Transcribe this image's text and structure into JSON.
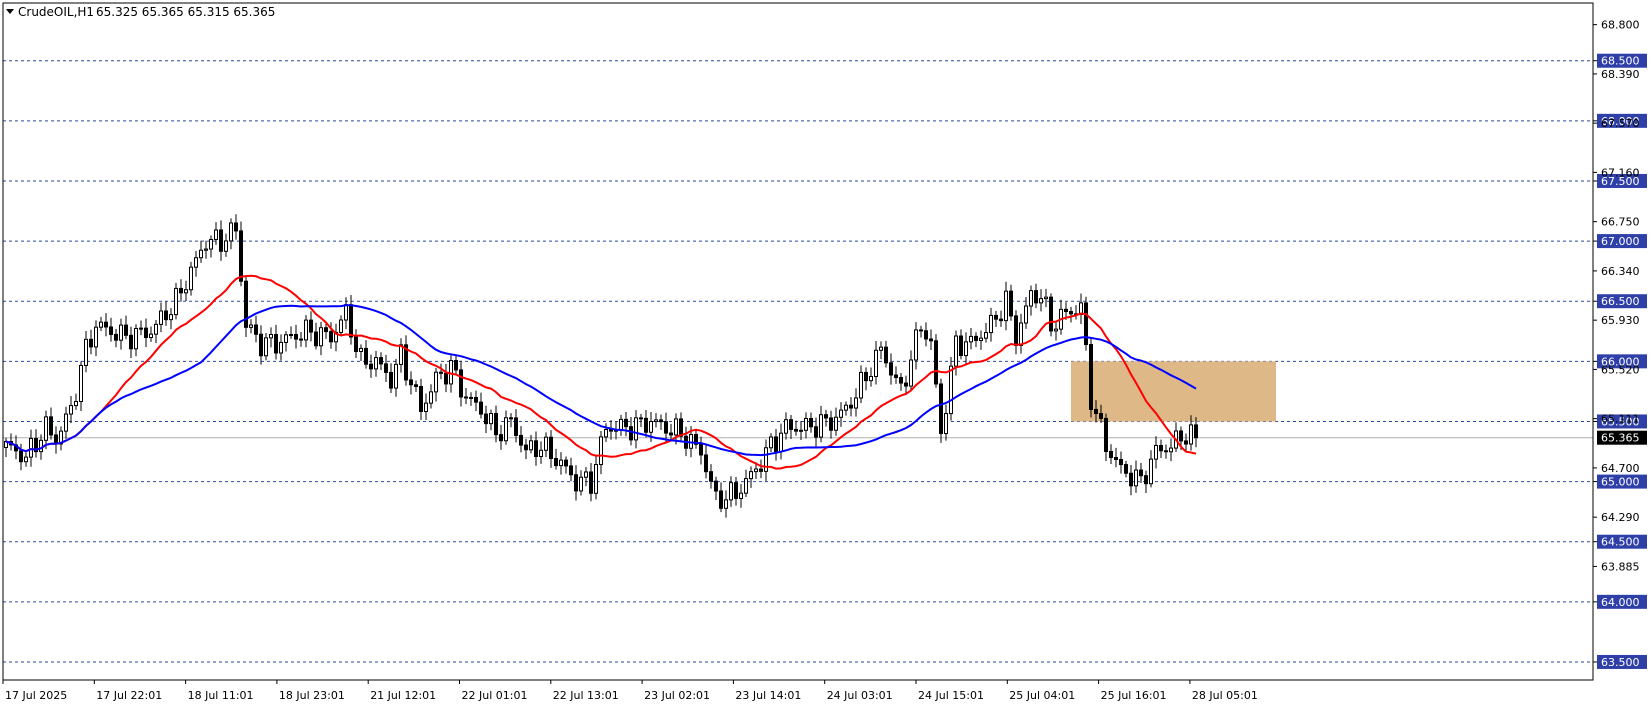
{
  "header": {
    "symbol_label": "CrudeOIL,H1",
    "ohlc_text": "65.325 65.365 65.315 65.365"
  },
  "colors": {
    "background": "#ffffff",
    "grid": "#2a4a9f",
    "bull_body": "#ffffff",
    "bear_body": "#000000",
    "ma_fast": "#ff0000",
    "ma_slow": "#0000ff",
    "zone_fill": "#deb887",
    "level_badge_bg": "#2f3fa8",
    "last_price_bg": "#000000"
  },
  "chart_data": {
    "type": "candlestick",
    "title": "CrudeOIL,H1",
    "ylim": [
      63.35,
      68.98
    ],
    "x_ticks": [
      "17 Jul 2025",
      "17 Jul 22:01",
      "18 Jul 11:01",
      "18 Jul 23:01",
      "21 Jul 12:01",
      "22 Jul 01:01",
      "22 Jul 13:01",
      "23 Jul 02:01",
      "23 Jul 14:01",
      "24 Jul 03:01",
      "24 Jul 15:01",
      "25 Jul 04:01",
      "25 Jul 16:01",
      "28 Jul 05:01"
    ],
    "y_ticks": [
      "68.800",
      "68.390",
      "67.570",
      "67.160",
      "66.750",
      "66.340",
      "65.930",
      "65.520",
      "65.111",
      "64.700",
      "64.290",
      "63.885"
    ],
    "level_lines": [
      {
        "value": 68.5,
        "label": "68.500"
      },
      {
        "value": 68.0,
        "label": "68.000"
      },
      {
        "value": 67.5,
        "label": "67.500"
      },
      {
        "value": 67.0,
        "label": "67.000"
      },
      {
        "value": 66.5,
        "label": "66.500"
      },
      {
        "value": 66.0,
        "label": "66.000"
      },
      {
        "value": 65.5,
        "label": "65.500"
      },
      {
        "value": 65.0,
        "label": "65.000"
      },
      {
        "value": 64.5,
        "label": "64.500"
      },
      {
        "value": 64.0,
        "label": "64.000"
      },
      {
        "value": 63.5,
        "label": "63.500"
      }
    ],
    "last_price": {
      "value": 65.365,
      "label": "65.365"
    },
    "zone": {
      "start_index": 213,
      "end_index": 254,
      "top": 66.0,
      "bottom": 65.5
    },
    "grid": false,
    "anchors": [
      [
        0,
        65.3
      ],
      [
        4,
        65.2
      ],
      [
        8,
        65.45
      ],
      [
        10,
        65.35
      ],
      [
        13,
        65.6
      ],
      [
        16,
        66.1
      ],
      [
        18,
        66.3
      ],
      [
        21,
        66.25
      ],
      [
        24,
        66.2
      ],
      [
        29,
        66.25
      ],
      [
        34,
        66.5
      ],
      [
        37,
        66.75
      ],
      [
        40,
        67.0
      ],
      [
        43,
        67.0
      ],
      [
        46,
        67.1
      ],
      [
        48,
        66.3
      ],
      [
        51,
        66.15
      ],
      [
        54,
        66.15
      ],
      [
        60,
        66.25
      ],
      [
        65,
        66.2
      ],
      [
        68,
        66.4
      ],
      [
        71,
        66.0
      ],
      [
        74,
        66.0
      ],
      [
        77,
        65.85
      ],
      [
        79,
        66.05
      ],
      [
        83,
        65.6
      ],
      [
        86,
        65.85
      ],
      [
        89,
        65.95
      ],
      [
        92,
        65.7
      ],
      [
        95,
        65.6
      ],
      [
        98,
        65.4
      ],
      [
        101,
        65.5
      ],
      [
        104,
        65.25
      ],
      [
        107,
        65.3
      ],
      [
        111,
        65.15
      ],
      [
        114,
        65.0
      ],
      [
        117,
        65.0
      ],
      [
        120,
        65.45
      ],
      [
        125,
        65.45
      ],
      [
        129,
        65.5
      ],
      [
        135,
        65.4
      ],
      [
        139,
        65.25
      ],
      [
        142,
        64.85
      ],
      [
        146,
        64.9
      ],
      [
        150,
        65.1
      ],
      [
        153,
        65.3
      ],
      [
        156,
        65.45
      ],
      [
        160,
        65.45
      ],
      [
        165,
        65.5
      ],
      [
        168,
        65.6
      ],
      [
        171,
        65.8
      ],
      [
        175,
        66.1
      ],
      [
        179,
        65.75
      ],
      [
        183,
        66.3
      ],
      [
        185,
        66.15
      ],
      [
        187,
        65.4
      ],
      [
        190,
        66.15
      ],
      [
        193,
        66.15
      ],
      [
        197,
        66.3
      ],
      [
        200,
        66.5
      ],
      [
        202,
        66.2
      ],
      [
        205,
        66.55
      ],
      [
        207,
        66.55
      ],
      [
        209,
        66.3
      ],
      [
        212,
        66.4
      ],
      [
        215,
        66.45
      ],
      [
        217,
        65.7
      ],
      [
        220,
        65.3
      ],
      [
        223,
        65.1
      ],
      [
        227,
        65.0
      ],
      [
        230,
        65.25
      ],
      [
        233,
        65.3
      ],
      [
        236,
        65.4
      ],
      [
        238,
        65.365
      ]
    ],
    "series": [
      {
        "name": "",
        "type": "ma",
        "period": 20,
        "color": "#ff0000"
      },
      {
        "name": "",
        "type": "ma",
        "period": 40,
        "color": "#0000ff"
      }
    ]
  }
}
